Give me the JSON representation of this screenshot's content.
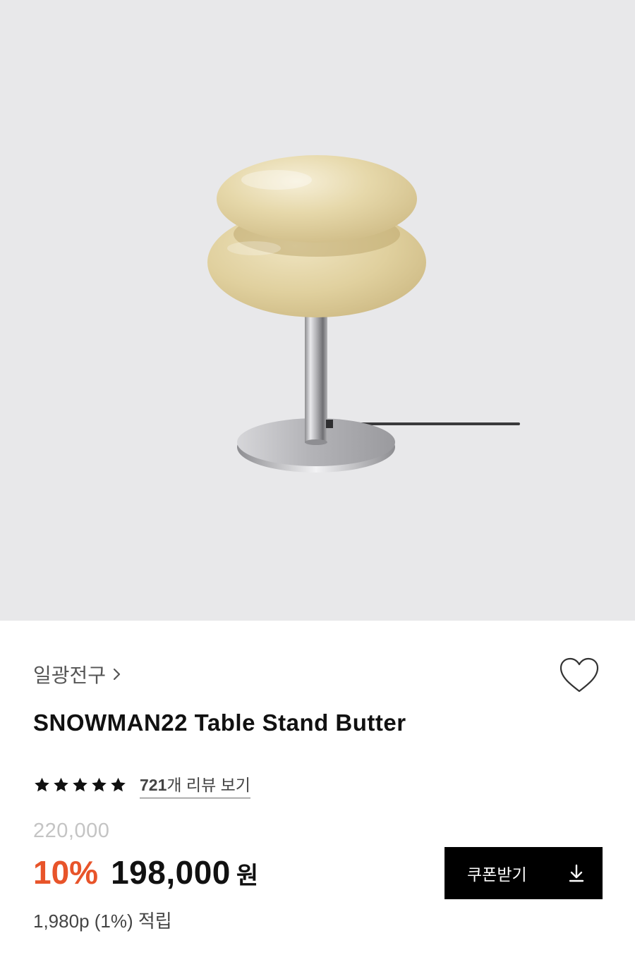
{
  "product": {
    "image_icon": "table-lamp-image",
    "brand": "일광전구",
    "title": "SNOWMAN22 Table Stand Butter",
    "rating": 5,
    "review_count": "721",
    "review_suffix": "개 리뷰 보기",
    "original_price": "220,000",
    "discount_rate": "10%",
    "sale_price": "198,000",
    "currency": "원",
    "points_text": "1,980p (1%) 적립",
    "coupon_button_label": "쿠폰받기"
  },
  "icons": {
    "brand_chevron": "chevron-right-icon",
    "wishlist": "heart-outline-icon",
    "rating": "star-icon",
    "coupon": "download-icon"
  },
  "colors": {
    "image_background": "#e8e8ea",
    "lamp_shade": "#e4d5a6",
    "discount": "#e8542a",
    "original_price": "#c4c4c4",
    "button_background": "#000000",
    "button_text": "#ffffff"
  }
}
